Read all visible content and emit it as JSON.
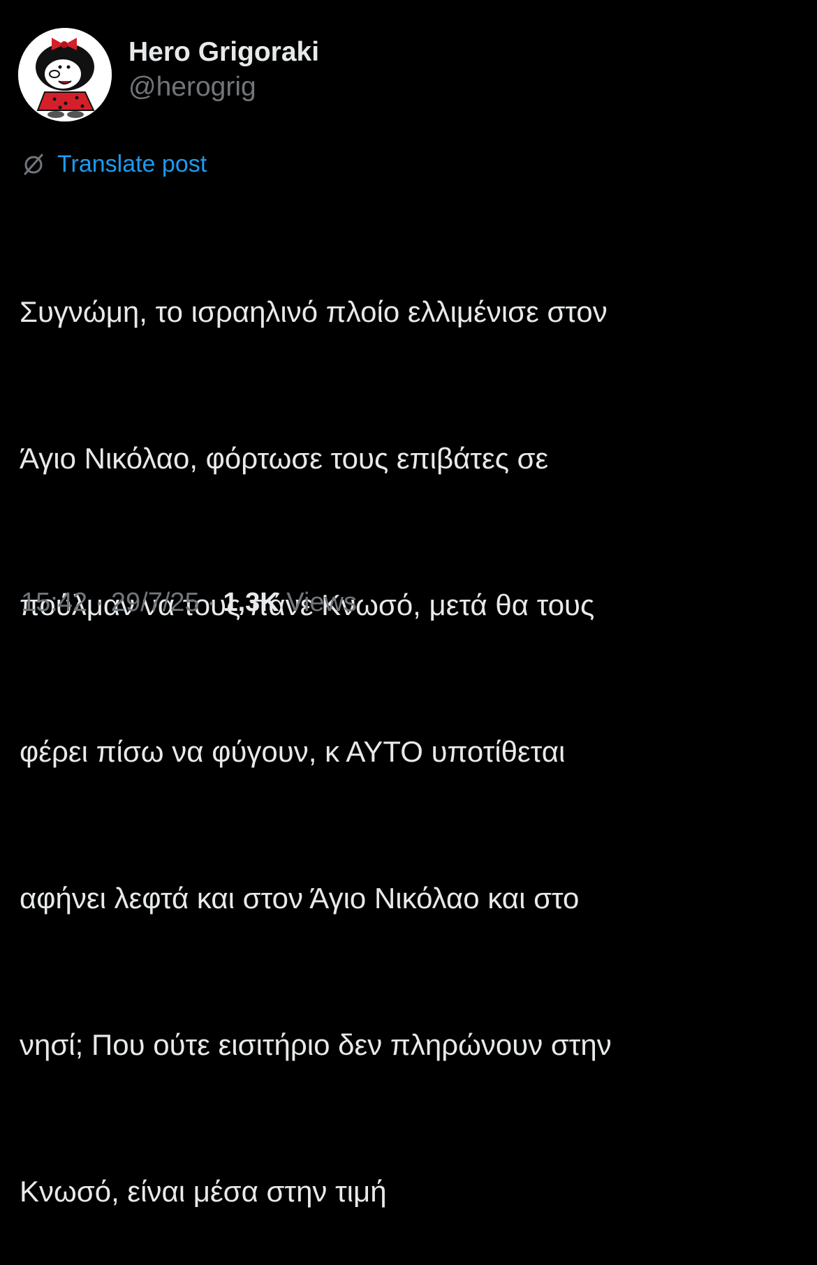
{
  "author": {
    "display_name": "Hero Grigoraki",
    "handle": "@herogrig",
    "avatar_icon": "cartoon-girl-avatar"
  },
  "translate": {
    "icon": "globe-slash-icon",
    "label": "Translate post",
    "link_color": "#1d9bf0"
  },
  "post": {
    "lines": [
      "Συγνώμη, το ισραηλινό πλοίο ελλιμένισε στον",
      "Άγιο Νικόλαο, φόρτωσε τους επιβάτες σε",
      "πούλμαν να τους πάνε Κνωσό, μετά θα τους",
      "φέρει πίσω να φύγουν, κ ΑΥΤΟ υποτίθεται",
      "αφήνει λεφτά και στον Άγιο Νικόλαο και στο",
      "νησί; Που ούτε εισιτήριο δεν πληρώνουν στην",
      "Κνωσό, είναι μέσα στην τιμή"
    ]
  },
  "meta": {
    "time": "15:42",
    "separator": " · ",
    "date": "29/7/25",
    "views_count": "1,3K",
    "views_label": " Views"
  },
  "colors": {
    "background": "#000000",
    "primary_text": "#e7e9ea",
    "secondary_text": "#71767b"
  }
}
